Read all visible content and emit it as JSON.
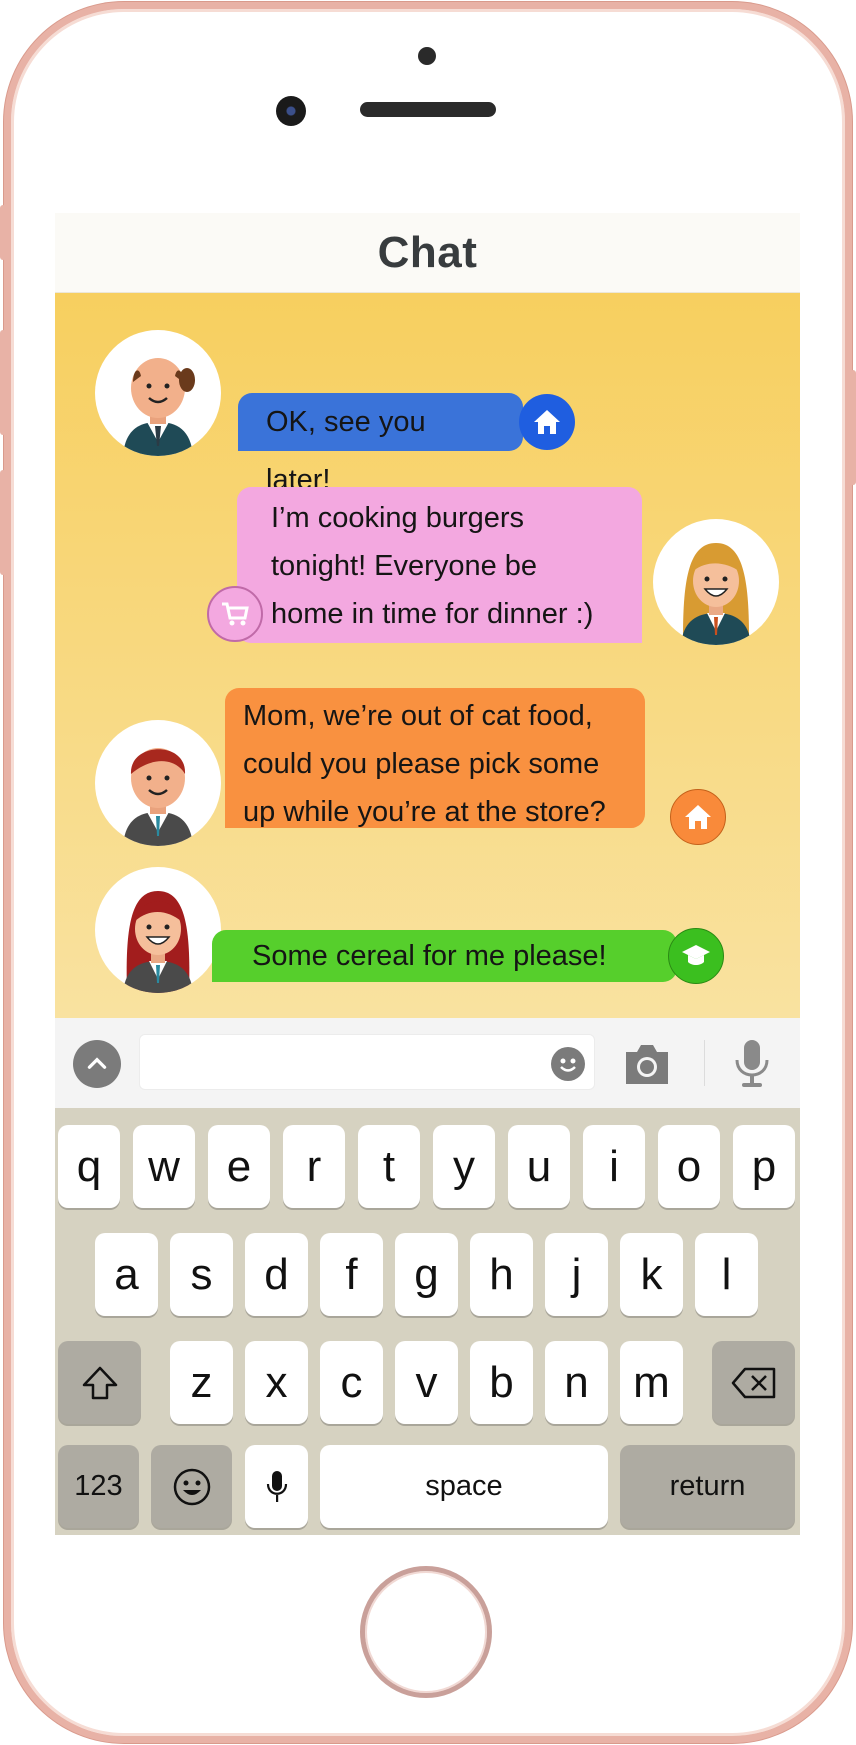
{
  "header": {
    "title": "Chat"
  },
  "messages": [
    {
      "text": "OK, see you later!",
      "bubble_color": "#3a73d9",
      "badge_color": "#1f5ee0",
      "badge_icon": "home-icon"
    },
    {
      "lines": [
        "I’m cooking burgers",
        "tonight! Everyone be",
        "home in time for dinner :)"
      ],
      "bubble_color": "#f3a8e0",
      "badge_color": "#f3a8e0",
      "badge_icon": "shopping-cart-icon"
    },
    {
      "lines": [
        "Mom, we’re out of cat food,",
        "could you please pick some",
        "up while you’re at the store?"
      ],
      "bubble_color": "#f99140",
      "badge_color": "#f98a3a",
      "badge_icon": "home-icon"
    },
    {
      "text": "Some cereal for me please!",
      "bubble_color": "#56cf2c",
      "badge_color": "#3bbf1f",
      "badge_icon": "graduation-cap-icon"
    }
  ],
  "input": {
    "value": ""
  },
  "keyboard": {
    "row1": [
      "q",
      "w",
      "e",
      "r",
      "t",
      "y",
      "u",
      "i",
      "o",
      "p"
    ],
    "row2": [
      "a",
      "s",
      "d",
      "f",
      "g",
      "h",
      "j",
      "k",
      "l"
    ],
    "row3": [
      "z",
      "x",
      "c",
      "v",
      "b",
      "n",
      "m"
    ],
    "numbers_label": "123",
    "space_label": "space",
    "return_label": "return"
  }
}
